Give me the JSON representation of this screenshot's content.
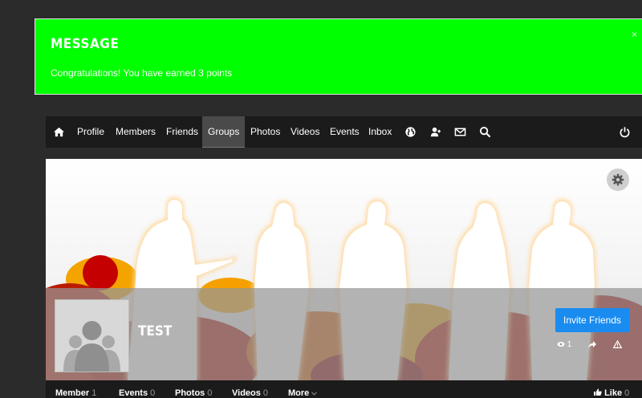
{
  "message": {
    "title": "MESSAGE",
    "text": "Congratulations! You have earned 3 points",
    "close": "×",
    "bg_color": "#00ff00"
  },
  "nav": {
    "home_icon": "home-icon",
    "items": [
      {
        "label": "Profile"
      },
      {
        "label": "Members"
      },
      {
        "label": "Friends"
      },
      {
        "label": "Groups",
        "active": true
      },
      {
        "label": "Photos"
      },
      {
        "label": "Videos"
      },
      {
        "label": "Events"
      },
      {
        "label": "Inbox"
      }
    ],
    "icons": [
      "globe-icon",
      "friend-request-icon",
      "mail-icon",
      "search-icon",
      "power-icon"
    ]
  },
  "group": {
    "name": "TEST",
    "invite_label": "Invite Friends",
    "views": "1",
    "accent_color": "#1a8cf0"
  },
  "tabs": [
    {
      "label": "Member",
      "count": "1"
    },
    {
      "label": "Events",
      "count": "0"
    },
    {
      "label": "Photos",
      "count": "0"
    },
    {
      "label": "Videos",
      "count": "0"
    },
    {
      "label": "More",
      "count": ""
    }
  ],
  "like": {
    "label": "Like",
    "count": "0"
  }
}
